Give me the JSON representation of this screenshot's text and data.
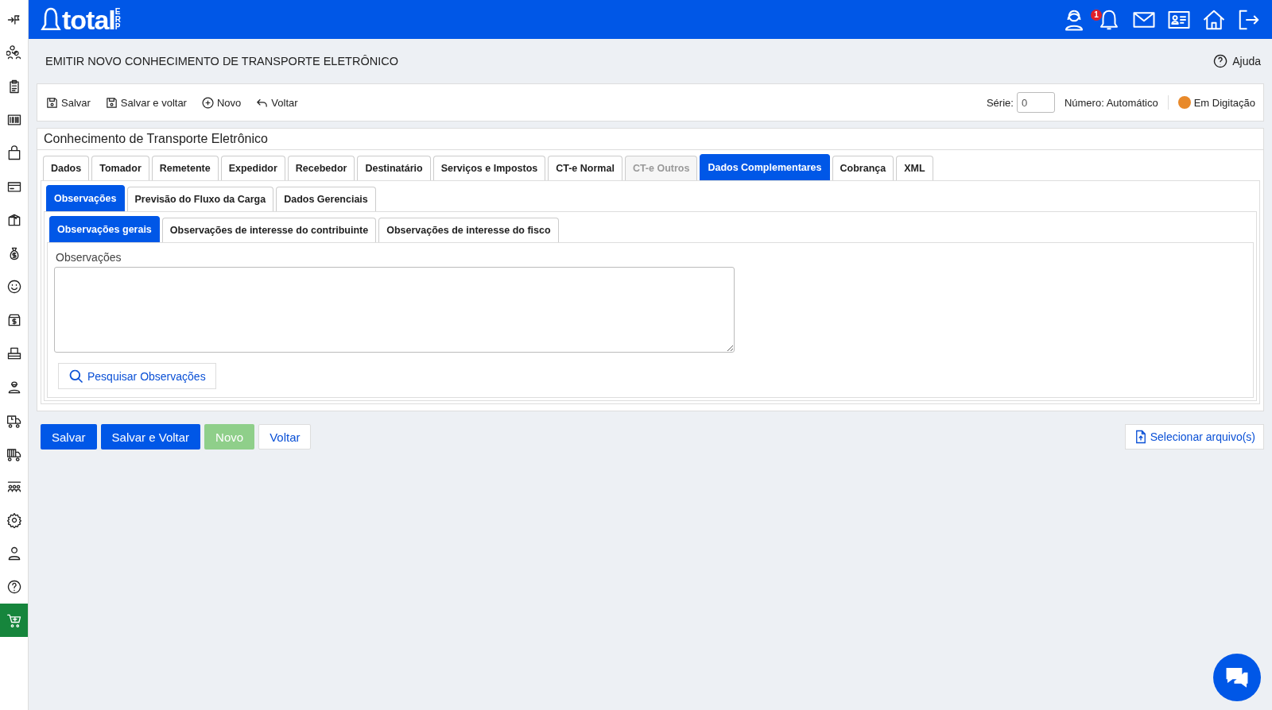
{
  "brand": {
    "logo": "total",
    "logo_suffix": "ERP"
  },
  "header": {
    "notification_count": "1"
  },
  "sidebar": {
    "items": [
      {
        "selected": false
      },
      {
        "selected": false
      },
      {
        "selected": false
      },
      {
        "selected": false
      },
      {
        "selected": false
      },
      {
        "selected": false
      },
      {
        "selected": false
      },
      {
        "selected": false
      },
      {
        "selected": false
      },
      {
        "selected": false
      },
      {
        "selected": false
      },
      {
        "selected": false
      },
      {
        "selected": false
      },
      {
        "selected": false
      },
      {
        "selected": false
      },
      {
        "selected": false
      },
      {
        "selected": false
      },
      {
        "selected": false
      },
      {
        "selected": true
      }
    ]
  },
  "page": {
    "title": "EMITIR NOVO CONHECIMENTO DE TRANSPORTE ELETRÔNICO",
    "help": "Ajuda"
  },
  "toolbar": {
    "actions": [
      "Salvar",
      "Salvar e voltar",
      "Novo",
      "Voltar"
    ],
    "serie_label": "Série:",
    "serie_value": "0",
    "numero": "Número: Automático",
    "status": {
      "label": "Em Digitação",
      "color": "#e8892a"
    }
  },
  "form": {
    "title": "Conhecimento de Transporte Eletrônico",
    "tabs": [
      {
        "label": "Dados",
        "selected": false,
        "disabled": false
      },
      {
        "label": "Tomador",
        "selected": false,
        "disabled": false
      },
      {
        "label": "Remetente",
        "selected": false,
        "disabled": false
      },
      {
        "label": "Expedidor",
        "selected": false,
        "disabled": false
      },
      {
        "label": "Recebedor",
        "selected": false,
        "disabled": false
      },
      {
        "label": "Destinatário",
        "selected": false,
        "disabled": false
      },
      {
        "label": "Serviços e Impostos",
        "selected": false,
        "disabled": false
      },
      {
        "label": "CT-e Normal",
        "selected": false,
        "disabled": false
      },
      {
        "label": "CT-e Outros",
        "selected": false,
        "disabled": true
      },
      {
        "label": "Dados Complementares",
        "selected": true,
        "disabled": false
      },
      {
        "label": "Cobrança",
        "selected": false,
        "disabled": false
      },
      {
        "label": "XML",
        "selected": false,
        "disabled": false
      }
    ],
    "subtabs": [
      {
        "label": "Observações",
        "selected": true
      },
      {
        "label": "Previsão do Fluxo da Carga",
        "selected": false
      },
      {
        "label": "Dados Gerenciais",
        "selected": false
      }
    ],
    "inner_tabs": [
      {
        "label": "Observações gerais",
        "selected": true
      },
      {
        "label": "Observações de interesse do contribuinte",
        "selected": false
      },
      {
        "label": "Observações de interesse do fisco",
        "selected": false
      }
    ],
    "field_label": "Observações",
    "search_button": "Pesquisar Observações"
  },
  "buttons": [
    {
      "label": "Salvar",
      "kind": "primary"
    },
    {
      "label": "Salvar e Voltar",
      "kind": "primary"
    },
    {
      "label": "Novo",
      "kind": "success"
    },
    {
      "label": "Voltar",
      "kind": "plain"
    }
  ],
  "upload_button": "Selecionar arquivo(s)"
}
